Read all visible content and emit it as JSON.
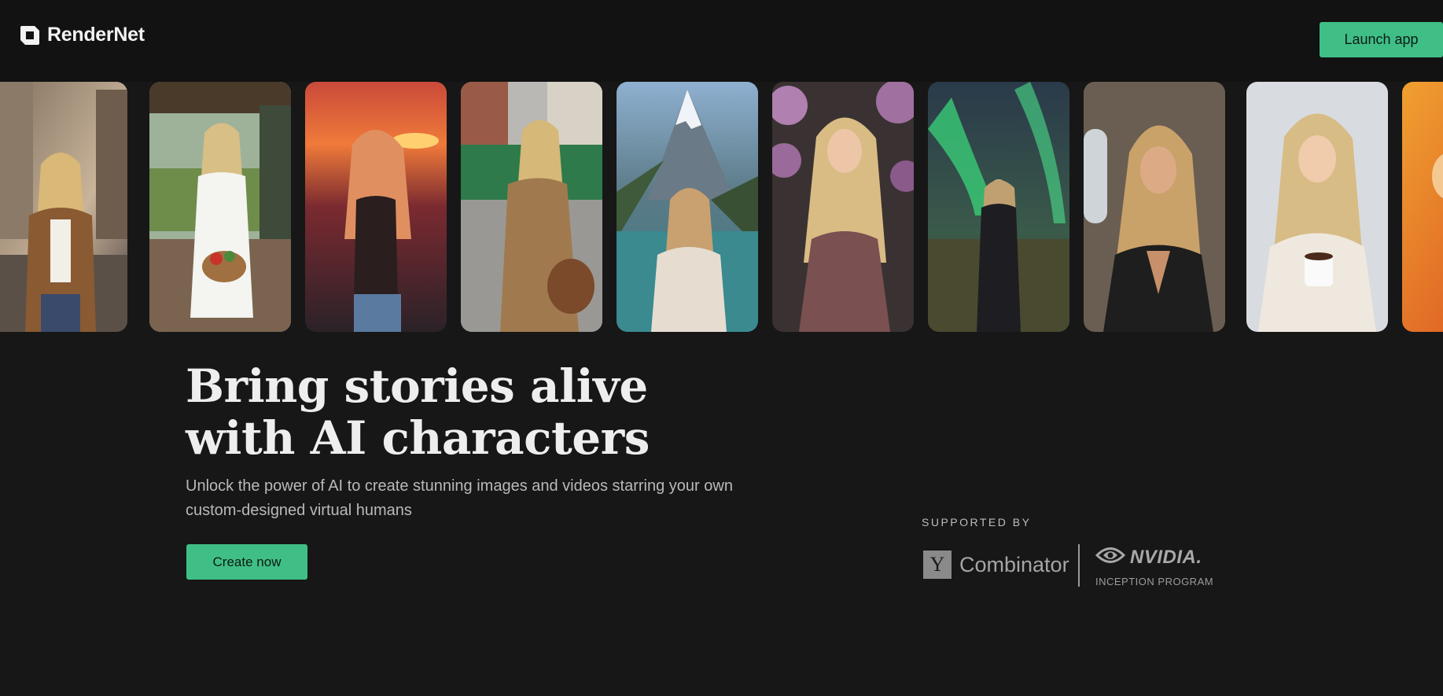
{
  "header": {
    "brand": "RenderNet",
    "launch_label": "Launch app"
  },
  "gallery": {
    "cards": [
      {
        "icon": "city-street-portrait-image"
      },
      {
        "icon": "farm-porch-portrait-image"
      },
      {
        "icon": "sunset-portrait-image"
      },
      {
        "icon": "tram-street-portrait-image"
      },
      {
        "icon": "mountain-lake-portrait-image"
      },
      {
        "icon": "flowers-portrait-image"
      },
      {
        "icon": "aurora-portrait-image"
      },
      {
        "icon": "airplane-portrait-image"
      },
      {
        "icon": "snow-coffee-portrait-image"
      },
      {
        "icon": "orange-portrait-image"
      }
    ]
  },
  "hero": {
    "title_line1": "Bring stories alive",
    "title_line2": "with AI characters",
    "subtitle": "Unlock the power of AI to create stunning images and videos starring your own custom-designed virtual humans",
    "cta_label": "Create now"
  },
  "supporters": {
    "label": "SUPPORTED BY",
    "yc_mark": "Y",
    "yc_name": "Combinator",
    "nvidia_name": "NVIDIA.",
    "nvidia_program": "INCEPTION PROGRAM"
  },
  "colors": {
    "accent": "#3fbf86",
    "background": "#171717",
    "header_bg": "#121212"
  }
}
